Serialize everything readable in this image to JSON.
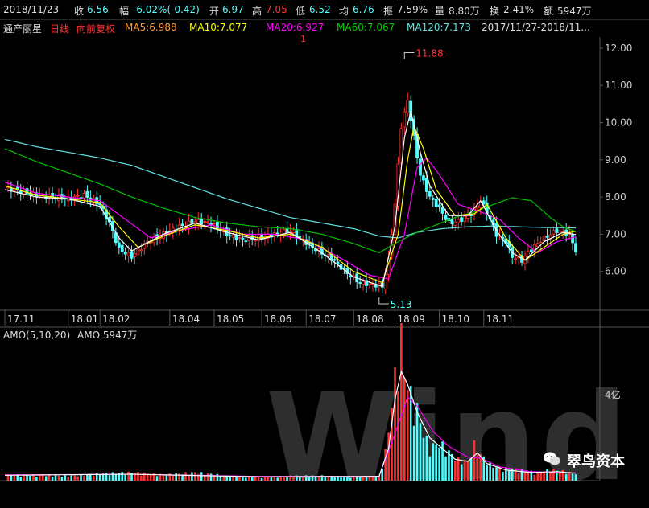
{
  "info": {
    "date": "2018/11/23",
    "close_label": "收",
    "close_value": "6.56",
    "range_label": "幅",
    "range_value": "-6.02%(-0.42)",
    "open_label": "开",
    "open_value": "6.97",
    "high_label": "高",
    "high_value": "7.05",
    "low_label": "低",
    "low_value": "6.52",
    "avg_label": "均",
    "avg_value": "6.76",
    "amp_label": "振",
    "amp_value": "7.59%",
    "vol_label": "量",
    "vol_value": "8.80万",
    "turn_label": "换",
    "turn_value": "2.41%",
    "amt_label": "额",
    "amt_value": "5947万"
  },
  "legend": {
    "stock_name": "通产丽星",
    "period": "日线",
    "adjust": "向前复权",
    "ma5": "MA5:6.988",
    "ma10": "MA10:7.077",
    "ma20": "MA20:6.927",
    "ma60": "MA60:7.067",
    "ma120": "MA120:7.173",
    "range": "2017/11/27-2018/11..."
  },
  "marker": {
    "top_marker": "1"
  },
  "annotations": {
    "high": "11.88",
    "low": "5.13"
  },
  "volume_panel": {
    "legend": "AMO(5,10,20)",
    "amo": "AMO:5947万",
    "tick": "4亿"
  },
  "watermark": "Wind",
  "brand": "翠鸟资本",
  "colors": {
    "up": "#ff3232",
    "down": "#54ffff",
    "ma5": "#ffffff",
    "ma10": "#ffff00",
    "ma20": "#ff00ff",
    "ma60": "#00c000",
    "ma120": "#60e0e0",
    "axis": "#555555"
  },
  "chart_data": [
    {
      "type": "candlestick",
      "title": "通产丽星 日线",
      "y_ticks": [
        "6.00",
        "7.00",
        "8.00",
        "9.00",
        "10.00",
        "11.00",
        "12.00"
      ],
      "ylim": [
        5.0,
        12.3
      ],
      "x_ticks": [
        "17.11",
        "18.01",
        "18.02",
        "18.04",
        "18.05",
        "18.06",
        "18.07",
        "18.08",
        "18.09",
        "18.10",
        "18.11"
      ],
      "grid": false,
      "highest": 11.88,
      "lowest": 5.13,
      "close_path": [
        [
          0,
          8.25
        ],
        [
          5,
          8.15
        ],
        [
          10,
          8.05
        ],
        [
          15,
          8.0
        ],
        [
          20,
          7.95
        ],
        [
          25,
          8.05
        ],
        [
          30,
          7.8
        ],
        [
          33,
          7.3
        ],
        [
          36,
          6.6
        ],
        [
          40,
          6.4
        ],
        [
          45,
          6.8
        ],
        [
          50,
          7.0
        ],
        [
          55,
          7.2
        ],
        [
          60,
          7.35
        ],
        [
          65,
          7.3
        ],
        [
          70,
          7.0
        ],
        [
          75,
          6.85
        ],
        [
          80,
          6.9
        ],
        [
          85,
          7.0
        ],
        [
          90,
          7.1
        ],
        [
          93,
          6.9
        ],
        [
          98,
          6.6
        ],
        [
          103,
          6.35
        ],
        [
          108,
          5.95
        ],
        [
          112,
          5.7
        ],
        [
          116,
          5.65
        ],
        [
          119,
          5.6
        ],
        [
          121,
          6.3
        ],
        [
          123,
          7.8
        ],
        [
          125,
          9.9
        ],
        [
          127,
          10.6
        ],
        [
          129,
          9.6
        ],
        [
          131,
          8.6
        ],
        [
          134,
          8.0
        ],
        [
          137,
          7.7
        ],
        [
          140,
          7.3
        ],
        [
          143,
          7.35
        ],
        [
          147,
          7.55
        ],
        [
          150,
          7.9
        ],
        [
          152,
          7.6
        ],
        [
          155,
          7.0
        ],
        [
          158,
          6.8
        ],
        [
          160,
          6.4
        ],
        [
          163,
          6.3
        ],
        [
          166,
          6.6
        ],
        [
          170,
          6.9
        ],
        [
          174,
          7.1
        ],
        [
          178,
          7.0
        ],
        [
          180,
          6.56
        ]
      ],
      "ma5": [
        [
          0,
          8.2
        ],
        [
          10,
          8.0
        ],
        [
          20,
          7.95
        ],
        [
          30,
          7.75
        ],
        [
          36,
          6.9
        ],
        [
          40,
          6.55
        ],
        [
          50,
          7.0
        ],
        [
          60,
          7.3
        ],
        [
          70,
          7.05
        ],
        [
          80,
          6.85
        ],
        [
          90,
          7.05
        ],
        [
          100,
          6.5
        ],
        [
          110,
          5.85
        ],
        [
          119,
          5.6
        ],
        [
          123,
          7.2
        ],
        [
          126,
          9.6
        ],
        [
          128,
          10.3
        ],
        [
          131,
          9.2
        ],
        [
          134,
          8.3
        ],
        [
          140,
          7.5
        ],
        [
          146,
          7.5
        ],
        [
          150,
          7.9
        ],
        [
          155,
          7.1
        ],
        [
          160,
          6.5
        ],
        [
          164,
          6.3
        ],
        [
          170,
          6.8
        ],
        [
          176,
          7.05
        ],
        [
          180,
          6.99
        ]
      ],
      "ma10": [
        [
          0,
          8.3
        ],
        [
          10,
          8.05
        ],
        [
          20,
          7.95
        ],
        [
          30,
          7.85
        ],
        [
          36,
          7.2
        ],
        [
          42,
          6.65
        ],
        [
          50,
          6.95
        ],
        [
          60,
          7.25
        ],
        [
          70,
          7.1
        ],
        [
          80,
          6.9
        ],
        [
          90,
          7.0
        ],
        [
          100,
          6.65
        ],
        [
          110,
          6.0
        ],
        [
          119,
          5.7
        ],
        [
          124,
          7.0
        ],
        [
          127,
          9.0
        ],
        [
          129,
          9.9
        ],
        [
          132,
          9.3
        ],
        [
          136,
          8.2
        ],
        [
          142,
          7.5
        ],
        [
          148,
          7.55
        ],
        [
          152,
          7.8
        ],
        [
          158,
          6.9
        ],
        [
          164,
          6.3
        ],
        [
          170,
          6.65
        ],
        [
          176,
          7.0
        ],
        [
          180,
          7.08
        ]
      ],
      "ma20": [
        [
          0,
          8.4
        ],
        [
          10,
          8.1
        ],
        [
          20,
          8.0
        ],
        [
          30,
          7.9
        ],
        [
          38,
          7.4
        ],
        [
          46,
          6.9
        ],
        [
          55,
          7.1
        ],
        [
          65,
          7.25
        ],
        [
          75,
          7.0
        ],
        [
          85,
          7.0
        ],
        [
          95,
          6.85
        ],
        [
          105,
          6.4
        ],
        [
          115,
          5.9
        ],
        [
          121,
          5.8
        ],
        [
          126,
          7.0
        ],
        [
          130,
          8.8
        ],
        [
          133,
          9.05
        ],
        [
          137,
          8.6
        ],
        [
          143,
          7.8
        ],
        [
          150,
          7.6
        ],
        [
          156,
          7.4
        ],
        [
          162,
          6.9
        ],
        [
          168,
          6.5
        ],
        [
          174,
          6.8
        ],
        [
          180,
          6.93
        ]
      ],
      "ma60": [
        [
          0,
          9.3
        ],
        [
          10,
          8.95
        ],
        [
          20,
          8.65
        ],
        [
          30,
          8.35
        ],
        [
          40,
          8.0
        ],
        [
          50,
          7.7
        ],
        [
          60,
          7.45
        ],
        [
          70,
          7.3
        ],
        [
          80,
          7.2
        ],
        [
          90,
          7.15
        ],
        [
          100,
          7.0
        ],
        [
          110,
          6.75
        ],
        [
          118,
          6.5
        ],
        [
          124,
          6.8
        ],
        [
          130,
          7.05
        ],
        [
          136,
          7.25
        ],
        [
          142,
          7.45
        ],
        [
          148,
          7.6
        ],
        [
          154,
          7.8
        ],
        [
          160,
          7.98
        ],
        [
          166,
          7.9
        ],
        [
          172,
          7.45
        ],
        [
          176,
          7.2
        ],
        [
          180,
          7.07
        ]
      ],
      "ma120": [
        [
          0,
          9.55
        ],
        [
          10,
          9.35
        ],
        [
          20,
          9.2
        ],
        [
          30,
          9.05
        ],
        [
          40,
          8.85
        ],
        [
          50,
          8.55
        ],
        [
          60,
          8.25
        ],
        [
          70,
          7.95
        ],
        [
          80,
          7.7
        ],
        [
          90,
          7.45
        ],
        [
          100,
          7.3
        ],
        [
          110,
          7.15
        ],
        [
          118,
          6.95
        ],
        [
          124,
          6.9
        ],
        [
          130,
          7.05
        ],
        [
          138,
          7.15
        ],
        [
          146,
          7.2
        ],
        [
          154,
          7.22
        ],
        [
          162,
          7.2
        ],
        [
          170,
          7.18
        ],
        [
          180,
          7.17
        ]
      ]
    },
    {
      "type": "bar",
      "title": "AMO(5,10,20)",
      "y_ticks": [
        "4亿"
      ],
      "ylim": [
        0,
        6.5
      ],
      "unit": "亿",
      "volume_path": [
        [
          0,
          0.25
        ],
        [
          20,
          0.2
        ],
        [
          30,
          0.3
        ],
        [
          40,
          0.35
        ],
        [
          50,
          0.25
        ],
        [
          60,
          0.35
        ],
        [
          70,
          0.2
        ],
        [
          80,
          0.15
        ],
        [
          90,
          0.2
        ],
        [
          100,
          0.2
        ],
        [
          110,
          0.15
        ],
        [
          118,
          0.2
        ],
        [
          120,
          1.2
        ],
        [
          122,
          3.2
        ],
        [
          124,
          5.5
        ],
        [
          125,
          6.0
        ],
        [
          126,
          4.6
        ],
        [
          128,
          3.6
        ],
        [
          130,
          3.0
        ],
        [
          132,
          2.0
        ],
        [
          134,
          1.4
        ],
        [
          137,
          1.6
        ],
        [
          140,
          1.2
        ],
        [
          143,
          0.9
        ],
        [
          146,
          0.8
        ],
        [
          148,
          1.5
        ],
        [
          150,
          1.1
        ],
        [
          153,
          0.7
        ],
        [
          156,
          0.5
        ],
        [
          160,
          0.5
        ],
        [
          164,
          0.4
        ],
        [
          168,
          0.35
        ],
        [
          172,
          0.45
        ],
        [
          176,
          0.4
        ],
        [
          180,
          0.3
        ]
      ],
      "ma5": [
        [
          0,
          0.25
        ],
        [
          40,
          0.3
        ],
        [
          80,
          0.18
        ],
        [
          118,
          0.2
        ],
        [
          121,
          1.5
        ],
        [
          123,
          3.8
        ],
        [
          125,
          5.1
        ],
        [
          127,
          4.5
        ],
        [
          130,
          3.2
        ],
        [
          134,
          2.0
        ],
        [
          138,
          1.5
        ],
        [
          142,
          1.0
        ],
        [
          146,
          0.9
        ],
        [
          149,
          1.3
        ],
        [
          152,
          0.8
        ],
        [
          158,
          0.5
        ],
        [
          166,
          0.38
        ],
        [
          174,
          0.42
        ],
        [
          180,
          0.35
        ]
      ],
      "ma10": [
        [
          0,
          0.27
        ],
        [
          40,
          0.3
        ],
        [
          80,
          0.2
        ],
        [
          118,
          0.2
        ],
        [
          123,
          2.2
        ],
        [
          127,
          3.9
        ],
        [
          130,
          3.5
        ],
        [
          135,
          2.3
        ],
        [
          140,
          1.6
        ],
        [
          146,
          1.1
        ],
        [
          150,
          1.05
        ],
        [
          156,
          0.65
        ],
        [
          166,
          0.42
        ],
        [
          180,
          0.37
        ]
      ]
    }
  ]
}
